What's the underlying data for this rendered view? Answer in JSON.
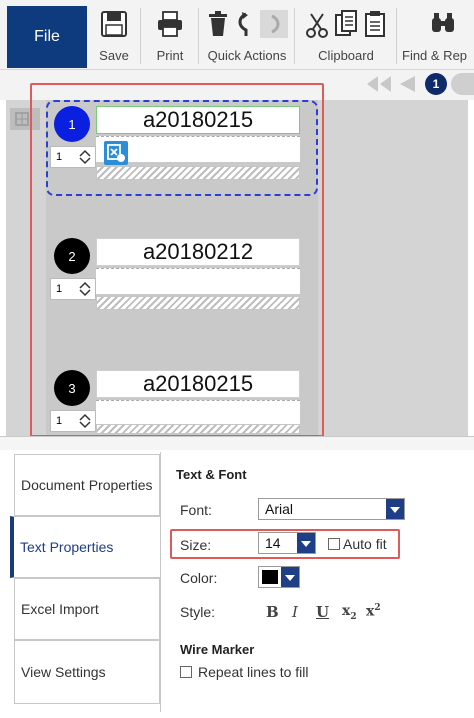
{
  "ribbon": {
    "file_label": "File",
    "save_label": "Save",
    "print_label": "Print",
    "quick_actions_label": "Quick Actions",
    "clipboard_label": "Clipboard",
    "find_label": "Find & Rep"
  },
  "nav": {
    "current_page": "1"
  },
  "labels": [
    {
      "number": "1",
      "text": "a20180215",
      "quantity": "1"
    },
    {
      "number": "2",
      "text": "a20180212",
      "quantity": "1"
    },
    {
      "number": "3",
      "text": "a20180215",
      "quantity": "1"
    }
  ],
  "side_tabs": {
    "document_properties": "Document Properties",
    "text_properties": "Text Properties",
    "excel_import": "Excel Import",
    "view_settings": "View Settings"
  },
  "text_font": {
    "heading": "Text & Font",
    "font_label": "Font:",
    "font_value": "Arial",
    "size_label": "Size:",
    "size_value": "14",
    "auto_fit_label": "Auto fit",
    "color_label": "Color:",
    "style_label": "Style:",
    "bold": "B",
    "italic": "I",
    "underline": "U",
    "subscript": "x",
    "subscript_mark": "2",
    "superscript": "x",
    "superscript_mark": "2"
  },
  "wire_marker": {
    "heading": "Wire Marker",
    "repeat_label": "Repeat lines to fill"
  },
  "colors": {
    "file_bg": "#0e3b7d",
    "accent": "#1e3e86",
    "highlight": "#e05a5a",
    "selected_label": "#0a1fe0"
  }
}
